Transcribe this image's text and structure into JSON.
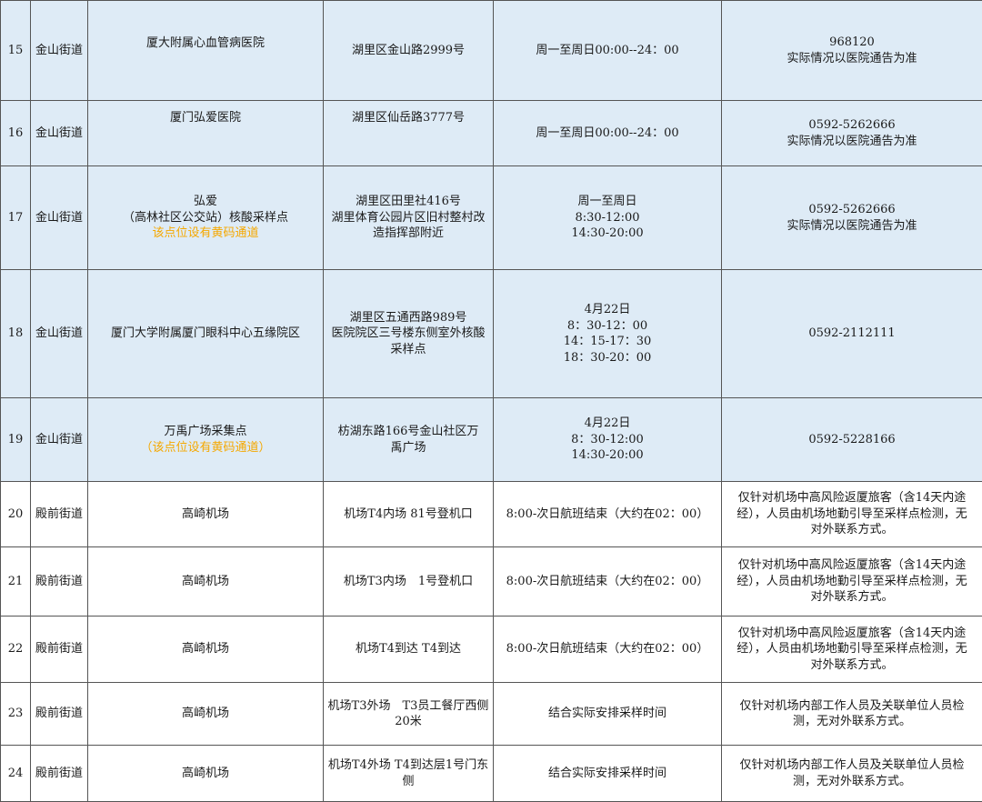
{
  "rows": [
    {
      "no": "15",
      "street": "金山街道",
      "site": [
        "厦大附属心血管病医院"
      ],
      "address": [
        "湖里区金山路2999号"
      ],
      "hours": [
        "周一至周日00:00--24：00"
      ],
      "contact": [
        "968120",
        "实际情况以医院通告为准"
      ]
    },
    {
      "no": "16",
      "street": "金山街道",
      "site": [
        "厦门弘爱医院"
      ],
      "address": [
        "湖里区仙岳路3777号"
      ],
      "hours": [
        "周一至周日00:00--24：00"
      ],
      "contact": [
        "0592-5262666",
        "实际情况以医院通告为准"
      ]
    },
    {
      "no": "17",
      "street": "金山街道",
      "site": [
        "弘爱",
        "（高林社区公交站）核酸采样点"
      ],
      "site_note": "该点位设有黄码通道",
      "address": [
        "湖里区田里社416号",
        "湖里体育公园片区旧村整村改",
        "造指挥部附近"
      ],
      "hours": [
        "周一至周日",
        "8:30-12:00",
        "14:30-20:00"
      ],
      "contact": [
        "0592-5262666",
        "实际情况以医院通告为准"
      ]
    },
    {
      "no": "18",
      "street": "金山街道",
      "site": [
        "厦门大学附属厦门眼科中心五缘院区"
      ],
      "address": [
        "湖里区五通西路989号",
        "医院院区三号楼东侧室外核酸",
        "采样点"
      ],
      "hours": [
        "4月22日",
        "8：30-12：00",
        "14：15-17：30",
        "18：30-20：00"
      ],
      "contact": [
        "0592-2112111"
      ]
    },
    {
      "no": "19",
      "street": "金山街道",
      "site": [
        "万禹广场采集点"
      ],
      "site_note": "（该点位设有黄码通道）",
      "address": [
        "枋湖东路166号金山社区万",
        "禹广场"
      ],
      "hours": [
        "4月22日",
        "8：30-12:00",
        "14:30-20:00"
      ],
      "contact": [
        "0592-5228166"
      ]
    },
    {
      "no": "20",
      "street": "殿前街道",
      "site": [
        "高崎机场"
      ],
      "address": [
        "机场T4内场 81号登机口"
      ],
      "hours": [
        "8:00-次日航班结束（大约在02：00）"
      ],
      "contact": [
        "仅针对机场中高风险返厦旅客（含14天内途",
        "经），人员由机场地勤引导至采样点检测，无",
        "对外联系方式。"
      ]
    },
    {
      "no": "21",
      "street": "殿前街道",
      "site": [
        "高崎机场"
      ],
      "address": [
        "机场T3内场　1号登机口"
      ],
      "hours": [
        "8:00-次日航班结束（大约在02：00）"
      ],
      "contact": [
        "仅针对机场中高风险返厦旅客（含14天内途",
        "经），人员由机场地勤引导至采样点检测，无",
        "对外联系方式。"
      ]
    },
    {
      "no": "22",
      "street": "殿前街道",
      "site": [
        "高崎机场"
      ],
      "address": [
        "机场T4到达 T4到达"
      ],
      "hours": [
        "8:00-次日航班结束（大约在02：00）"
      ],
      "contact": [
        "仅针对机场中高风险返厦旅客（含14天内途",
        "经），人员由机场地勤引导至采样点检测，无",
        "对外联系方式。"
      ]
    },
    {
      "no": "23",
      "street": "殿前街道",
      "site": [
        "高崎机场"
      ],
      "address": [
        "机场T3外场　T3员工餐厅西侧",
        "20米"
      ],
      "hours": [
        "结合实际安排采样时间"
      ],
      "contact": [
        "仅针对机场内部工作人员及关联单位人员检",
        "测，无对外联系方式。"
      ]
    },
    {
      "no": "24",
      "street": "殿前街道",
      "site": [
        "高崎机场"
      ],
      "address": [
        "机场T4外场 T4到达层1号门东",
        "侧"
      ],
      "hours": [
        "结合实际安排采样时间"
      ],
      "contact": [
        "仅针对机场内部工作人员及关联单位人员检",
        "测，无对外联系方式。"
      ]
    }
  ]
}
